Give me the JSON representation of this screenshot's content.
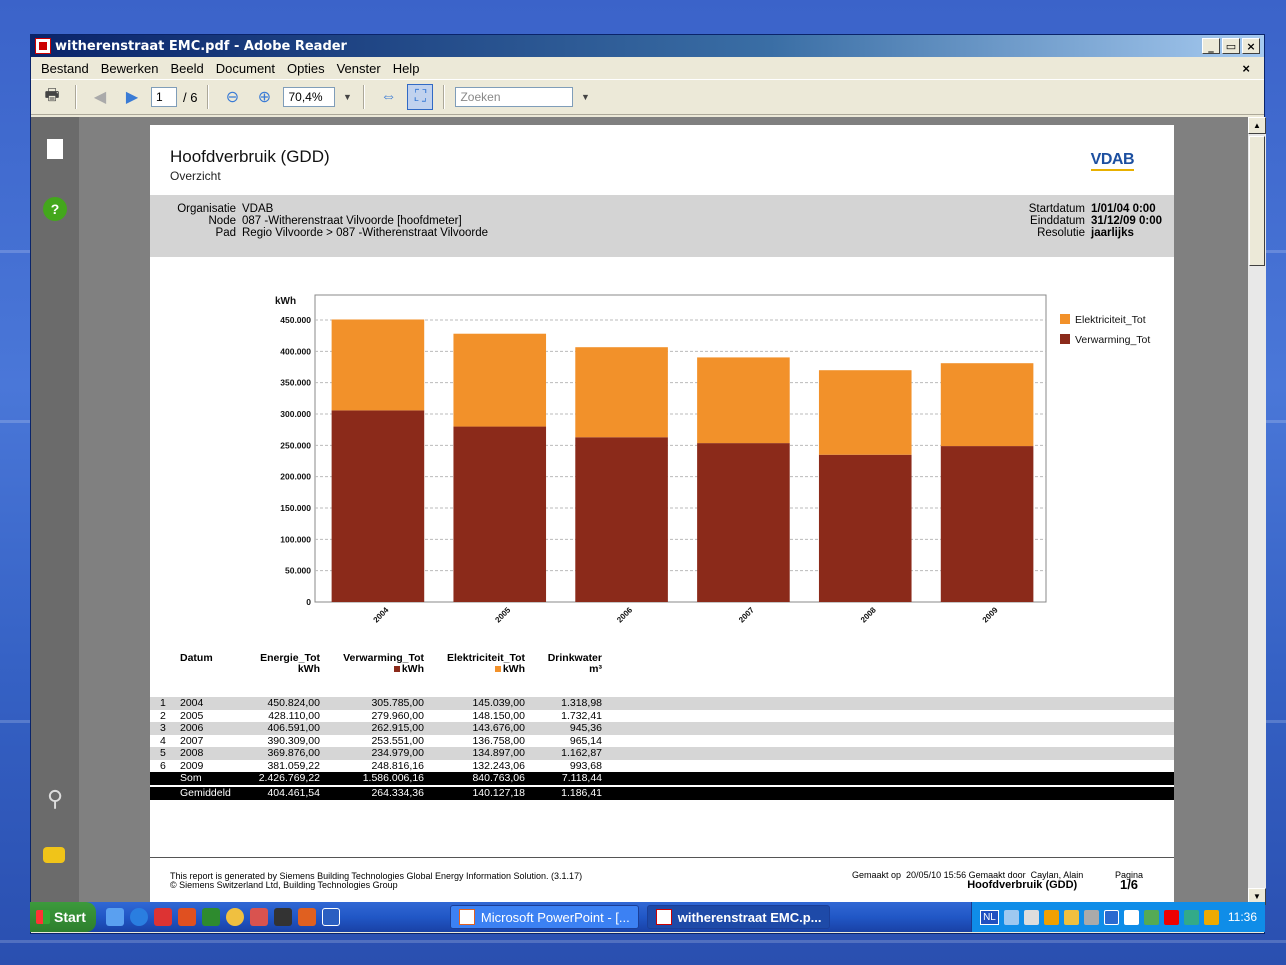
{
  "window": {
    "title": "witherenstraat EMC.pdf - Adobe Reader",
    "controls": [
      "_",
      "▭",
      "×"
    ]
  },
  "menu": [
    "Bestand",
    "Bewerken",
    "Beeld",
    "Document",
    "Opties",
    "Venster",
    "Help"
  ],
  "toolbar": {
    "page_current": "1",
    "page_total": "/ 6",
    "zoom": "70,4%",
    "search_placeholder": "Zoeken"
  },
  "report": {
    "title": "Hoofdverbruik (GDD)",
    "subtitle": "Overzicht",
    "logo": "VDAB",
    "info_left": [
      {
        "k": "Organisatie",
        "v": "VDAB"
      },
      {
        "k": "Node",
        "v": "087 -Witherenstraat Vilvoorde [hoofdmeter]"
      },
      {
        "k": "Pad",
        "v": "Regio Vilvoorde > 087 -Witherenstraat Vilvoorde"
      }
    ],
    "info_right": [
      {
        "k": "Startdatum",
        "v": "1/01/04 0:00"
      },
      {
        "k": "Einddatum",
        "v": "31/12/09 0:00"
      },
      {
        "k": "Resolutie",
        "v": "jaarlijks"
      }
    ]
  },
  "chart_data": {
    "type": "bar",
    "stacked": true,
    "ylabel": "kWh",
    "categories": [
      "2004",
      "2005",
      "2006",
      "2007",
      "2008",
      "2009"
    ],
    "ylim": [
      0,
      450000
    ],
    "yticks": [
      "0",
      "50.000",
      "100.000",
      "150.000",
      "200.000",
      "250.000",
      "300.000",
      "350.000",
      "400.000",
      "450.000"
    ],
    "series": [
      {
        "name": "Verwarming_Tot",
        "color": "#8b2a1a",
        "values": [
          305785,
          279960,
          262915,
          253551,
          234979,
          248816
        ]
      },
      {
        "name": "Elektriciteit_Tot",
        "color": "#f2912a",
        "values": [
          145039,
          148150,
          143676,
          136758,
          134897,
          132243
        ]
      }
    ],
    "legend": [
      "Elektriciteit_Tot",
      "Verwarming_Tot"
    ],
    "grid": true,
    "legend_position": "right"
  },
  "table": {
    "headers": [
      {
        "label": "Datum",
        "unit": ""
      },
      {
        "label": "Energie_Tot",
        "unit": "kWh"
      },
      {
        "label": "Verwarming_Tot",
        "unit": "kWh"
      },
      {
        "label": "Elektriciteit_Tot",
        "unit": "kWh"
      },
      {
        "label": "Drinkwater",
        "unit": "m³"
      }
    ],
    "rows": [
      [
        "1",
        "2004",
        "450.824,00",
        "305.785,00",
        "145.039,00",
        "1.318,98"
      ],
      [
        "2",
        "2005",
        "428.110,00",
        "279.960,00",
        "148.150,00",
        "1.732,41"
      ],
      [
        "3",
        "2006",
        "406.591,00",
        "262.915,00",
        "143.676,00",
        "945,36"
      ],
      [
        "4",
        "2007",
        "390.309,00",
        "253.551,00",
        "136.758,00",
        "965,14"
      ],
      [
        "5",
        "2008",
        "369.876,00",
        "234.979,00",
        "134.897,00",
        "1.162,87"
      ],
      [
        "6",
        "2009",
        "381.059,22",
        "248.816,16",
        "132.243,06",
        "993,68"
      ]
    ],
    "sum": [
      "Som",
      "2.426.769,22",
      "1.586.006,16",
      "840.763,06",
      "7.118,44"
    ],
    "avg": [
      "Gemiddeld",
      "404.461,54",
      "264.334,36",
      "140.127,18",
      "1.186,41"
    ]
  },
  "footer": {
    "line1": "This report is generated by Siemens Building Technologies Global Energy Information Solution. (3.1.17)",
    "line2": "© Siemens Switzerland Ltd, Building Technologies Group",
    "made_on_label": "Gemaakt op",
    "made_on": "20/05/10 15:56",
    "made_by_label": "Gemaakt door",
    "made_by": "Caylan, Alain",
    "report_name": "Hoofdverbruik (GDD)",
    "page_label": "Pagina",
    "page": "1/6"
  },
  "taskbar": {
    "start": "Start",
    "tasks": [
      "Microsoft PowerPoint - [...",
      "witherenstraat EMC.p..."
    ],
    "lang": "NL",
    "clock": "11:36"
  }
}
